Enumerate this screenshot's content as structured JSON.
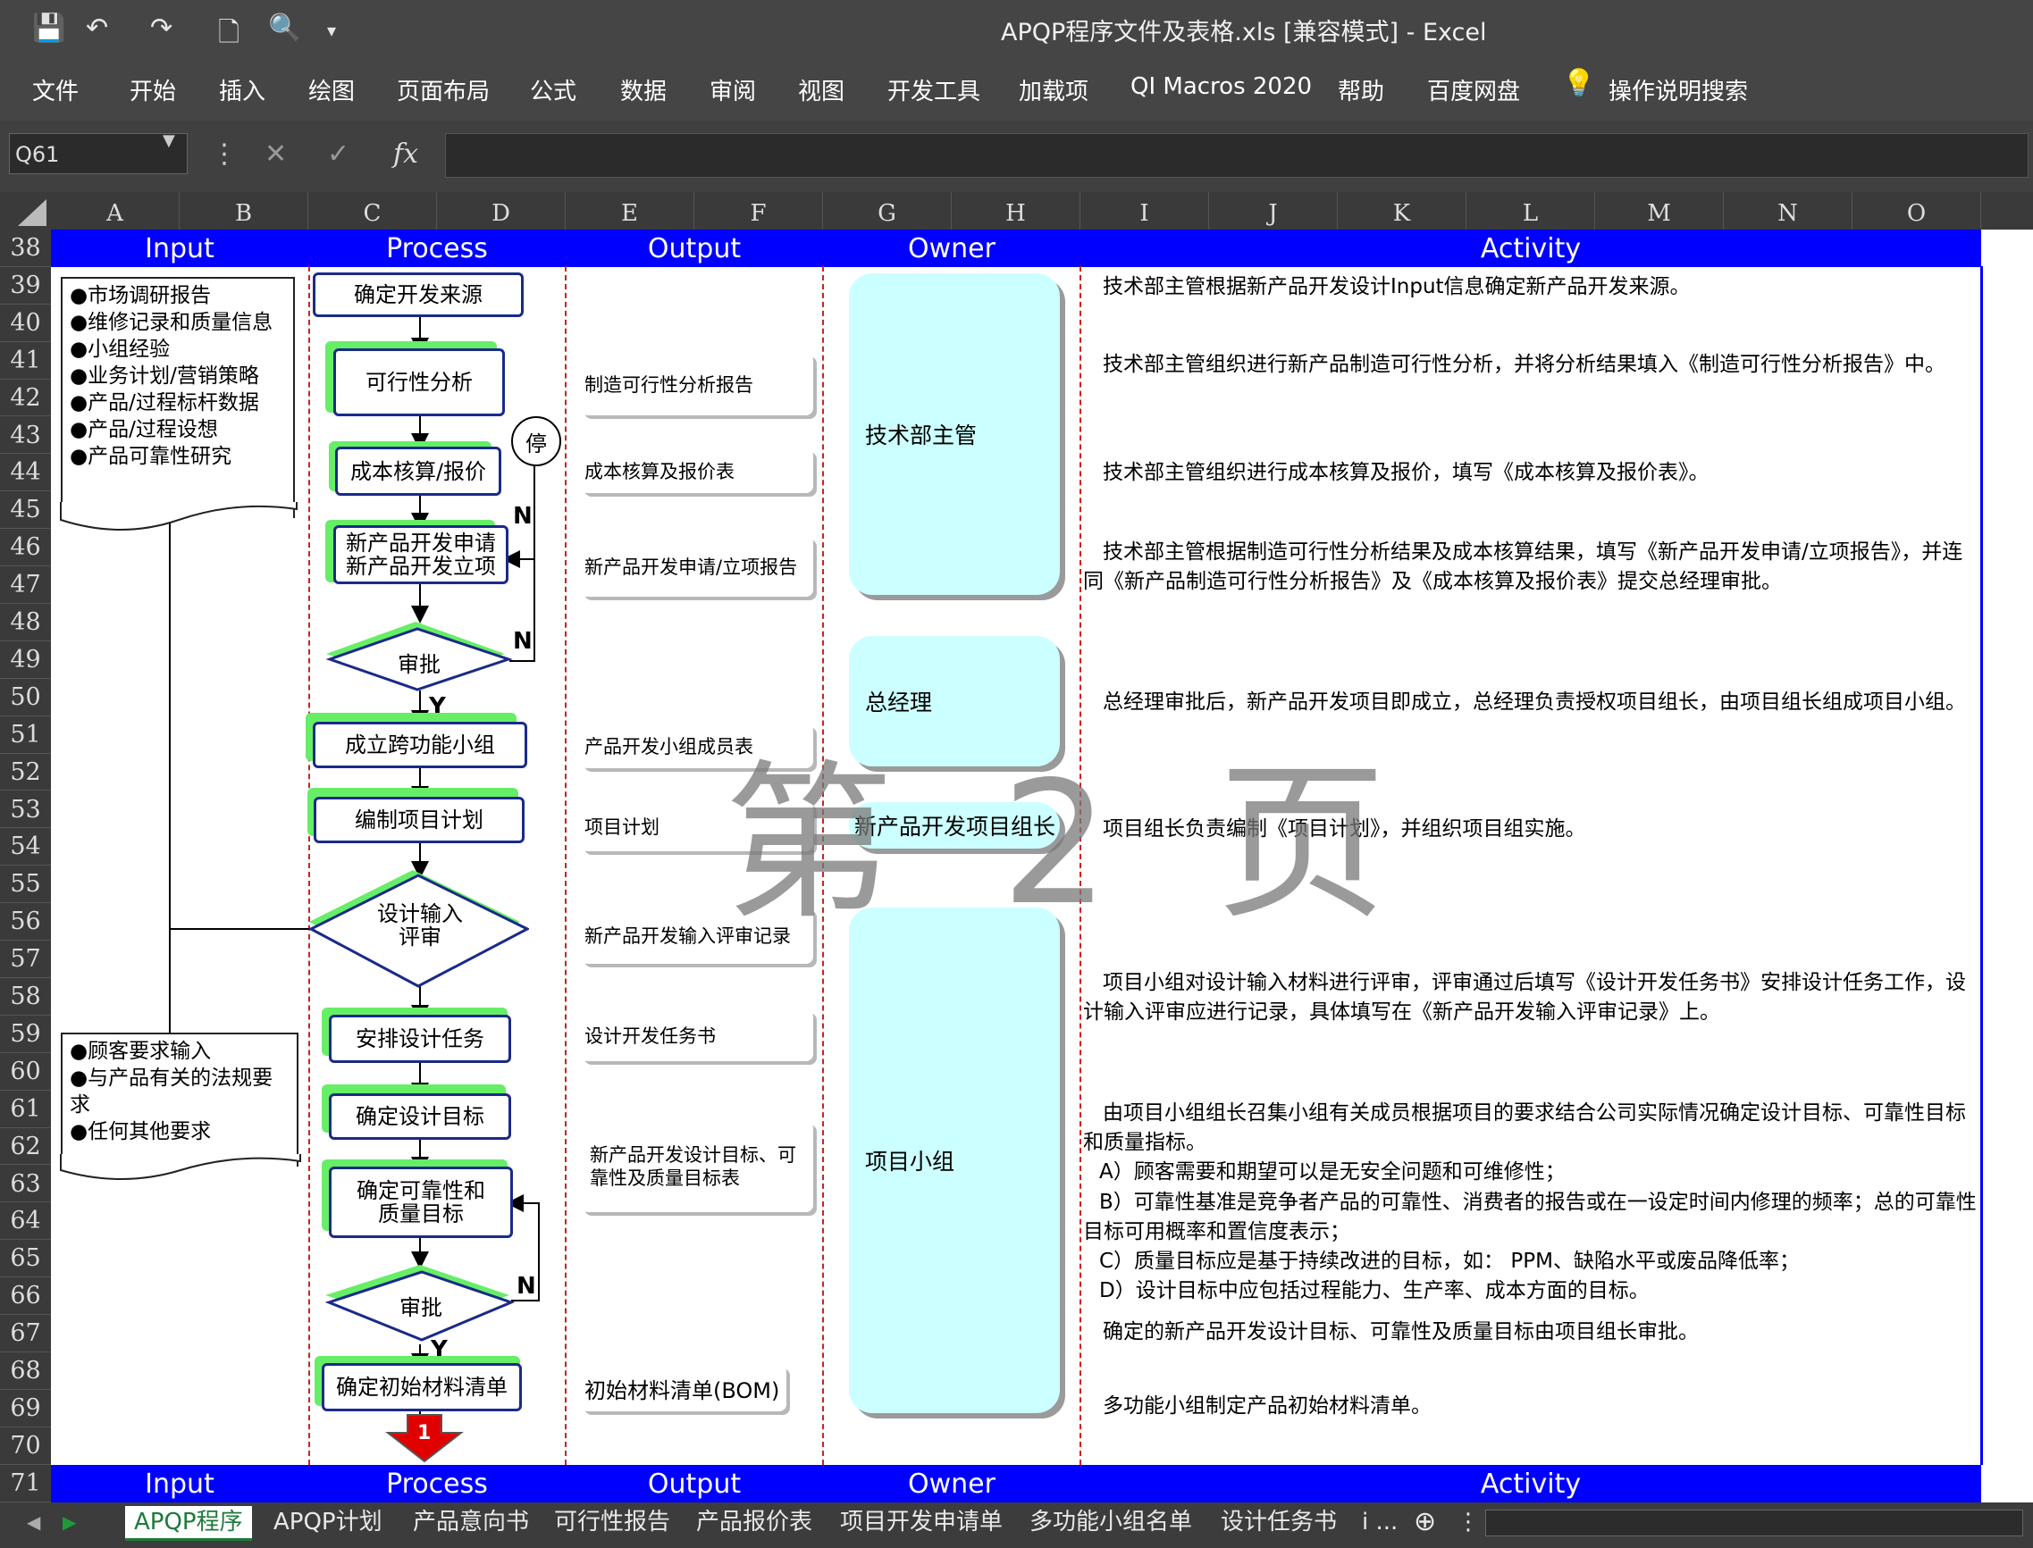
{
  "window": {
    "title": "APQP程序文件及表格.xls  [兼容模式]  -  Excel"
  },
  "ribbon": {
    "tabs": [
      "文件",
      "开始",
      "插入",
      "绘图",
      "页面布局",
      "公式",
      "数据",
      "审阅",
      "视图",
      "开发工具",
      "加载项",
      "QI Macros 2020",
      "帮助",
      "百度网盘"
    ],
    "search_label": "操作说明搜索"
  },
  "formula_bar": {
    "name_box": "Q61",
    "fx_label": "fx",
    "value": ""
  },
  "columns": [
    "A",
    "B",
    "C",
    "D",
    "E",
    "F",
    "G",
    "H",
    "I",
    "J",
    "K",
    "L",
    "M",
    "N",
    "O"
  ],
  "rows": [
    "38",
    "39",
    "40",
    "41",
    "42",
    "43",
    "44",
    "45",
    "46",
    "47",
    "48",
    "49",
    "50",
    "51",
    "52",
    "53",
    "54",
    "55",
    "56",
    "57",
    "58",
    "59",
    "60",
    "61",
    "62",
    "63",
    "64",
    "65",
    "66",
    "67",
    "68",
    "69",
    "70",
    "71"
  ],
  "header_band": {
    "input": "Input",
    "process": "Process",
    "output": "Output",
    "owner": "Owner",
    "activity": "Activity"
  },
  "inputs": {
    "doc1": [
      "●市场调研报告",
      "●维修记录和质量信息",
      "●小组经验",
      "●业务计划/营销策略",
      "●产品/过程标杆数据",
      "●产品/过程设想",
      "●产品可靠性研究"
    ],
    "doc2": [
      "●顾客要求输入",
      "●与产品有关的法规要",
      "  求",
      "●任何其他要求"
    ]
  },
  "process": {
    "p1": "确定开发来源",
    "p2": "可行性分析",
    "p3": "成本核算/报价",
    "p4a": "新产品开发申请",
    "p4b": "新产品开发立项",
    "d1": "审批",
    "p5": "成立跨功能小组",
    "p6": "编制项目计划",
    "d2a": "设计输入",
    "d2b": "评审",
    "p7": "安排设计任务",
    "p8": "确定设计目标",
    "p9a": "确定可靠性和",
    "p9b": "质量目标",
    "d3": "审批",
    "p10": "确定初始材料清单",
    "stop": "停",
    "n": "N",
    "y": "Y",
    "offpage": "1"
  },
  "outputs": [
    "制造可行性分析报告",
    "成本核算及报价表",
    "新产品开发申请/立项报告",
    "产品开发小组成员表",
    "项目计划",
    "新产品开发输入评审记录",
    "设计开发任务书",
    "新产品开发设计目标、可靠性及质量目标表",
    "初始材料清单(BOM)"
  ],
  "owners": [
    "技术部主管",
    "总经理",
    "新产品开发项目组长",
    "项目小组"
  ],
  "activities": {
    "a1": "技术部主管根据新产品开发设计Input信息确定新产品开发来源。",
    "a2": "技术部主管组织进行新产品制造可行性分析，并将分析结果填入《制造可行性分析报告》中。",
    "a3": "技术部主管组织进行成本核算及报价，填写《成本核算及报价表》。",
    "a4": "技术部主管根据制造可行性分析结果及成本核算结果，填写《新产品开发申请/立项报告》，并连同《新产品制造可行性分析报告》及《成本核算及报价表》提交总经理审批。",
    "a5": "总经理审批后，新产品开发项目即成立，总经理负责授权项目组长，由项目组长组成项目小组。",
    "a6": "项目组长负责编制《项目计划》，并组织项目组实施。",
    "a7": "项目小组对设计输入材料进行评审，评审通过后填写《设计开发任务书》安排设计任务工作，设计输入评审应进行记录，具体填写在《新产品开发输入评审记录》上。",
    "a8": "由项目小组组长召集小组有关成员根据项目的要求结合公司实际情况确定设计目标、可靠性目标和质量指标。",
    "a8a": "A）顾客需要和期望可以是无安全问题和可维修性；",
    "a8b": "B）可靠性基准是竞争者产品的可靠性、消费者的报告或在一设定时间内修理的频率；总的可靠性目标可用概率和置信度表示；",
    "a8c": "C）质量目标应是基于持续改进的目标，如： PPM、缺陷水平或废品降低率；",
    "a8d": "D）设计目标中应包括过程能力、生产率、成本方面的目标。",
    "a9": "确定的新产品开发设计目标、可靠性及质量目标由项目组长审批。",
    "a10": "多功能小组制定产品初始材料清单。"
  },
  "watermark": "第 2 页",
  "sheet_tabs": [
    "APQP程序",
    "APQP计划",
    "产品意向书",
    "可行性报告",
    "产品报价表",
    "项目开发申请单",
    "多功能小组名单",
    "设计任务书",
    "i ..."
  ],
  "active_tab": "APQP程序",
  "colors": {
    "band": "#0000ff",
    "owner_fill": "#ccffff",
    "shadow_green": "#66ee66",
    "process_border": "#1a2a8a",
    "offpage_red": "#e00000"
  }
}
